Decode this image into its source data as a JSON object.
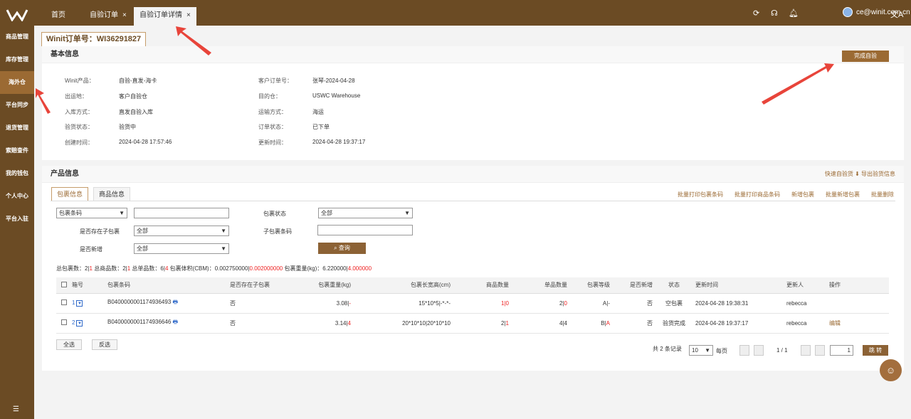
{
  "sidebar": {
    "items": [
      "商品管理",
      "库存管理",
      "海外仓",
      "平台同步",
      "退货管理",
      "索赔查件",
      "我的钱包",
      "个人中心",
      "平台入驻"
    ],
    "active": "海外仓",
    "collapse_icon": "menu-collapse-icon"
  },
  "topbar": {
    "tabs": [
      {
        "label": "首页",
        "close": ""
      },
      {
        "label": "自验订单",
        "close": "×"
      },
      {
        "label": "自验订单详情",
        "close": "×"
      }
    ],
    "user_email": "ce@winit.com.cn",
    "icons": [
      "refresh-icon",
      "headset-icon",
      "bell-icon",
      "translate-icon"
    ]
  },
  "order_tab": "Winit订单号：WI36291827",
  "basic": {
    "title": "基本信息",
    "complete_button": "完成自验",
    "left": [
      {
        "label": "Winit产品：",
        "value": "自验-直发-海卡"
      },
      {
        "label": "出运地：",
        "value": "客户自验仓"
      },
      {
        "label": "入库方式：",
        "value": "直发自验入库"
      },
      {
        "label": "验货状态：",
        "value": "验货中"
      },
      {
        "label": "创建时间：",
        "value": "2024-04-28 17:57:46"
      }
    ],
    "right": [
      {
        "label": "客户订单号：",
        "value": "张琴-2024-04-28"
      },
      {
        "label": "目的仓：",
        "value": "USWC Warehouse"
      },
      {
        "label": "运输方式：",
        "value": "海运"
      },
      {
        "label": "订单状态：",
        "value": "已下单"
      },
      {
        "label": "更新时间：",
        "value": "2024-04-28 19:37:17"
      }
    ]
  },
  "product": {
    "title": "产品信息",
    "quick_check": "快速自验货",
    "export": "导出验货信息",
    "tabs": [
      "包裹信息",
      "商品信息"
    ],
    "bulk_actions": [
      "批量打印包裹条码",
      "批量打印商品条码",
      "新增包裹",
      "批量新增包裹",
      "批量删除"
    ],
    "filters": {
      "barcode_type": "包裹条码",
      "barcode_value": "",
      "package_status_label": "包裹状态",
      "package_status": "全部",
      "has_sub_label": "是否存在子包裹",
      "has_sub": "全部",
      "sub_barcode_label": "子包裹条码",
      "sub_barcode": "",
      "is_new_label": "是否新增",
      "is_new": "全部",
      "search_button": "查询"
    },
    "summary": {
      "p1": "总包裹数：2|",
      "r1": "1",
      "p2": "   总商品数：2|",
      "r2": "1",
      "p3": "   总单品数：6|",
      "r3": "4",
      "p4": "   包裹体积(CBM)：0.002750000|",
      "r4": "0.002000000",
      "p5": "   包裹重量(kg)：6.220000|",
      "r5": "4.000000"
    },
    "columns": [
      "",
      "箱号",
      "包裹条码",
      "是否存在子包裹",
      "包裹重量(kg)",
      "包裹长宽高(cm)",
      "商品数量",
      "单品数量",
      "包裹等级",
      "是否新增",
      "状态",
      "更新时间",
      "更新人",
      "操作"
    ],
    "rows": [
      {
        "box": "1",
        "barcode": "B0400000001174936493",
        "has_sub": "否",
        "weight": "3.08|",
        "weight_r": "-",
        "dims": "15*10*5|-*-*-",
        "qty": "1|",
        "qty_r": "0",
        "units": "2|",
        "units_r": "0",
        "grade": "A|",
        "grade_r": "-",
        "is_new": "否",
        "status": "空包裹",
        "updated": "2024-04-28 19:38:31",
        "updater": "rebecca",
        "action": ""
      },
      {
        "box": "2",
        "barcode": "B0400000001174936646",
        "has_sub": "否",
        "weight": "3.14|",
        "weight_r": "4",
        "dims": "20*10*10|20*10*10",
        "qty": "2|",
        "qty_r": "1",
        "units": "4|4",
        "units_r": "",
        "grade": "B|",
        "grade_r": "A",
        "is_new": "否",
        "status": "验货完成",
        "updated": "2024-04-28 19:37:17",
        "updater": "rebecca",
        "action": "编辑"
      }
    ],
    "select_all": "全选",
    "invert": "反选",
    "pager": {
      "total": "共 2 条记录",
      "per_page": "10",
      "per_page_label": "每页",
      "pages": "1 / 1",
      "page_input": "1",
      "jump": "跳 转"
    }
  },
  "colors": {
    "brand": "#6b4b24",
    "accent": "#9b6a33",
    "annotation": "#e8443a"
  }
}
